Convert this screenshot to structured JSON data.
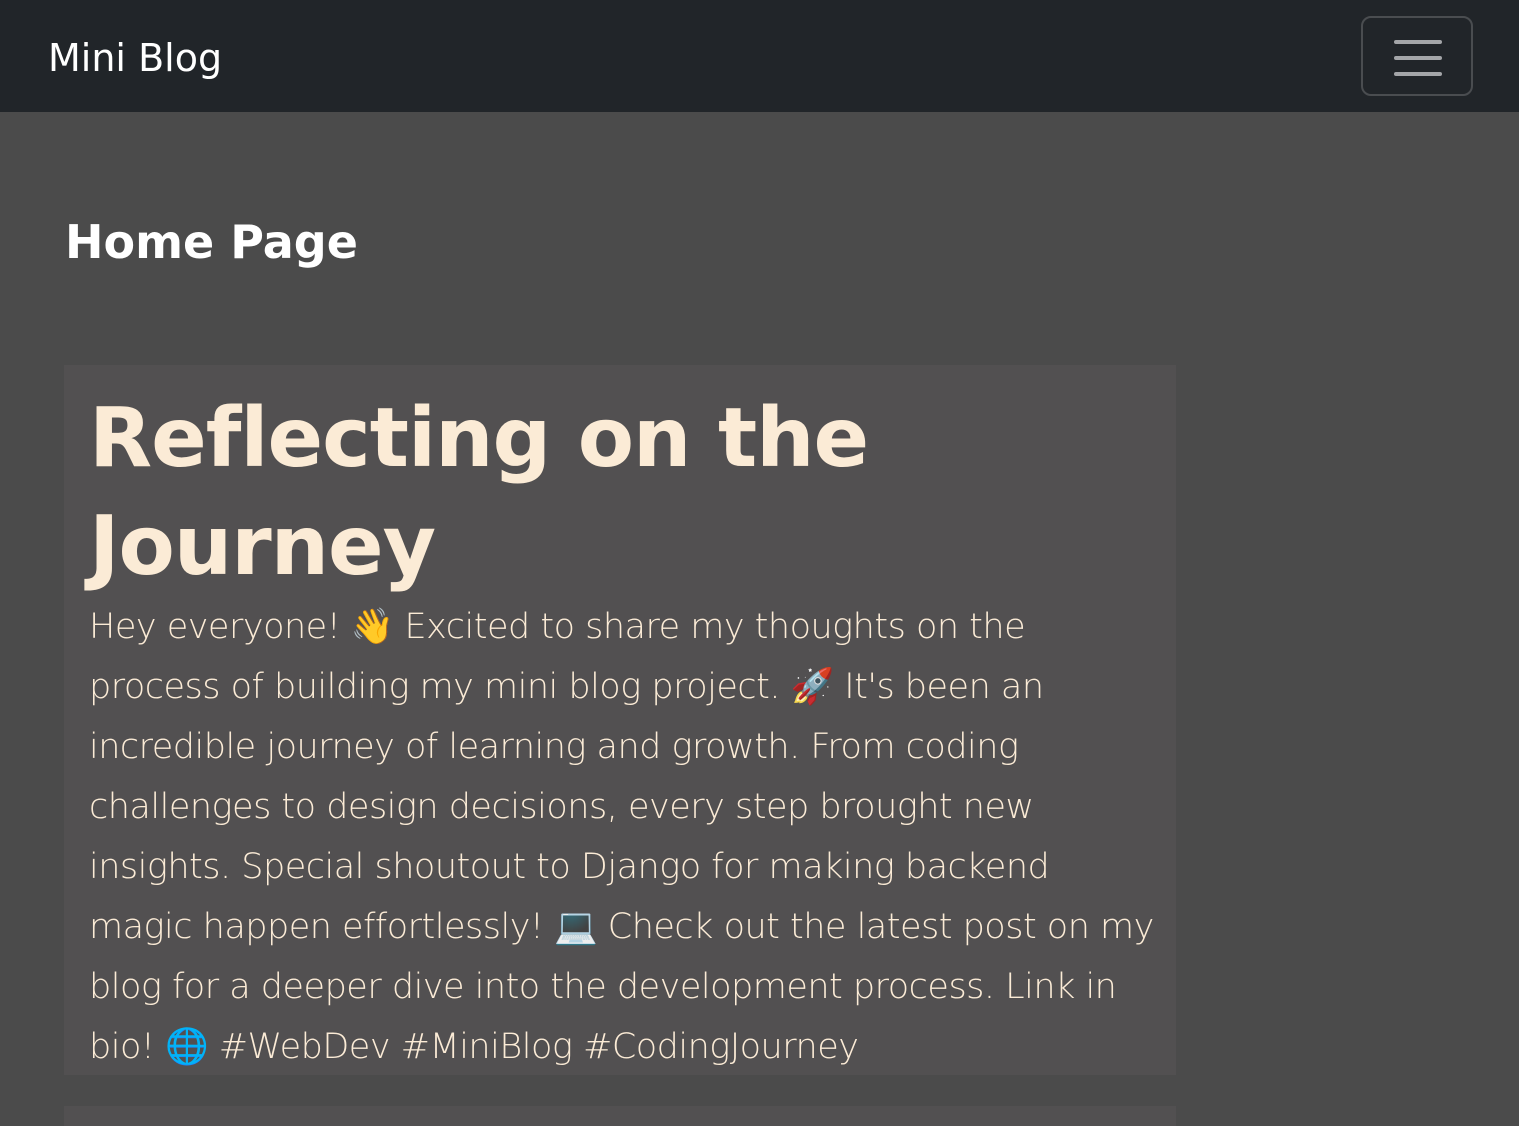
{
  "navbar": {
    "brand": "Mini Blog",
    "toggler_icon": "hamburger-menu-icon"
  },
  "page": {
    "title": "Home Page"
  },
  "posts": [
    {
      "title": "Reflecting on the Journey",
      "body": "Hey everyone! 👋 Excited to share my thoughts on the process of building my mini blog project. 🚀 It's been an incredible journey of learning and growth. From coding challenges to design decisions, every step brought new insights. Special shoutout to Django for making backend magic happen effortlessly! 💻 Check out the latest post on my blog for a deeper dive into the development process. Link in bio! 🌐 #WebDev #MiniBlog #CodingJourney"
    }
  ],
  "colors": {
    "navbar_bg": "#212529",
    "page_bg": "#4b4b4b",
    "card_bg": "#525051",
    "post_text": "#fbebd6"
  }
}
